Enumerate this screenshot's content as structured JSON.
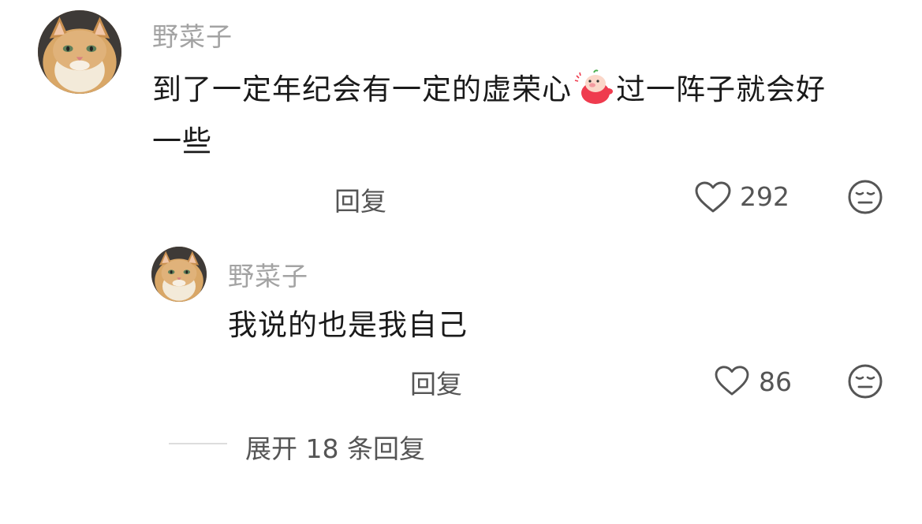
{
  "comment": {
    "username": "野菜子",
    "text_part1": "到了一定年纪会有一定的虚荣心",
    "emoji_icon": "shy-piggy-emoji-icon",
    "text_part2": "过一阵子就会好",
    "text_part3": "一些",
    "reply_label": "回复",
    "like_count": "292",
    "like_icon": "heart-outline-icon",
    "dislike_icon": "neutral-face-icon"
  },
  "reply": {
    "username": "野菜子",
    "text": "我说的也是我自己",
    "reply_label": "回复",
    "like_count": "86",
    "like_icon": "heart-outline-icon",
    "dislike_icon": "neutral-face-icon"
  },
  "expand": {
    "label": "展开 18 条回复"
  },
  "colors": {
    "username": "#a3a3a3",
    "text": "#1a1a1a",
    "secondary": "#555555",
    "divider": "#dddddd"
  }
}
